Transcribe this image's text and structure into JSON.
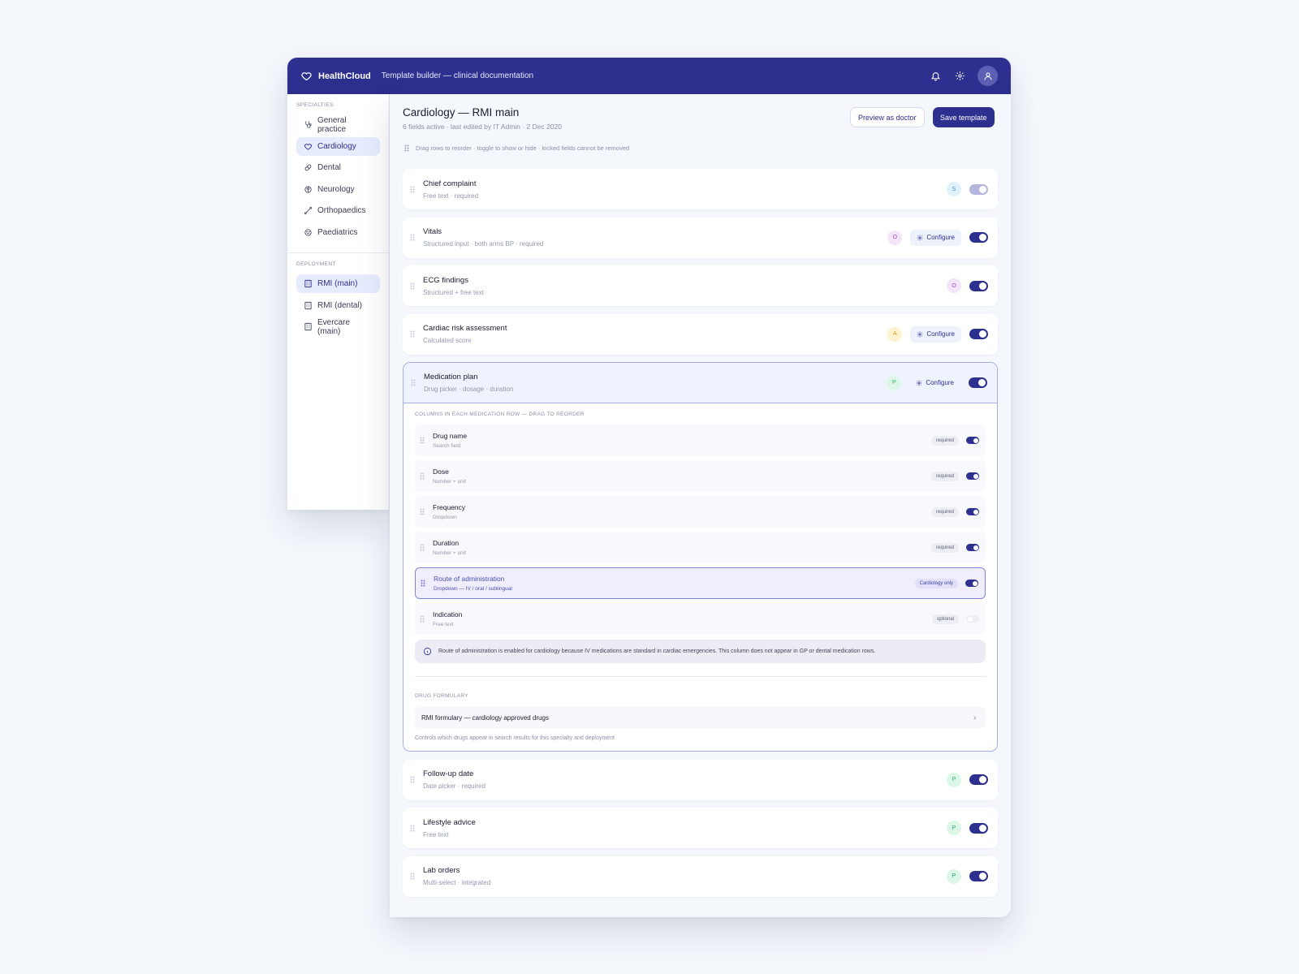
{
  "app": {
    "brand": "HealthCloud",
    "title": "Template builder — clinical documentation"
  },
  "sidebar": {
    "specialties_heading": "SPECIALTIES",
    "specialties": [
      {
        "label": "General practice",
        "icon": "stethoscope-icon",
        "active": false
      },
      {
        "label": "Cardiology",
        "icon": "heart-icon",
        "active": true
      },
      {
        "label": "Dental",
        "icon": "pill-icon",
        "active": false
      },
      {
        "label": "Neurology",
        "icon": "brain-icon",
        "active": false
      },
      {
        "label": "Orthopaedics",
        "icon": "bone-icon",
        "active": false
      },
      {
        "label": "Paediatrics",
        "icon": "baby-icon",
        "active": false
      }
    ],
    "deployment_heading": "DEPLOYMENT",
    "deployments": [
      {
        "label": "RMI (main)",
        "icon": "building-icon",
        "active": true
      },
      {
        "label": "RMI (dental)",
        "icon": "building-icon",
        "active": false
      },
      {
        "label": "Evercare (main)",
        "icon": "building-icon",
        "active": false
      }
    ]
  },
  "page": {
    "title": "Cardiology — RMI main",
    "subtitle": "6 fields active · last edited by IT Admin · 2 Dec 2020",
    "preview_button": "Preview as doctor",
    "save_button": "Save template",
    "hint": "Drag rows to reorder · toggle to show or hide · locked fields cannot be removed"
  },
  "fields_before": [
    {
      "name": "Chief complaint",
      "desc": "Free text · required",
      "badge": "S",
      "configure": false,
      "toggle": "locked"
    },
    {
      "name": "Vitals",
      "desc": "Structured input · both arms BP · required",
      "badge": "O",
      "configure": true,
      "toggle": "on"
    },
    {
      "name": "ECG findings",
      "desc": "Structured + free text",
      "badge": "O",
      "configure": false,
      "toggle": "on"
    },
    {
      "name": "Cardiac risk assessment",
      "desc": "Calculated score",
      "badge": "A",
      "configure": true,
      "toggle": "on"
    }
  ],
  "configure_label": "Configure",
  "medication": {
    "name": "Medication plan",
    "desc": "Drug picker · dosage · duration",
    "badge": "P",
    "columns_heading": "COLUMNS IN EACH MEDICATION ROW — DRAG TO REORDER",
    "columns": [
      {
        "name": "Drug name",
        "desc": "Search field",
        "tag": "required",
        "toggle": "on",
        "highlight": false
      },
      {
        "name": "Dose",
        "desc": "Number + unit",
        "tag": "required",
        "toggle": "on",
        "highlight": false
      },
      {
        "name": "Frequency",
        "desc": "Dropdown",
        "tag": "required",
        "toggle": "on",
        "highlight": false
      },
      {
        "name": "Duration",
        "desc": "Number + unit",
        "tag": "required",
        "toggle": "on",
        "highlight": false
      },
      {
        "name": "Route of administration",
        "desc": "Dropdown — IV / oral / sublingual",
        "tag": "Cardiology only",
        "toggle": "on",
        "highlight": true
      },
      {
        "name": "Indication",
        "desc": "Free text",
        "tag": "optional",
        "toggle": "off",
        "highlight": false
      }
    ],
    "info": "Route of administration is enabled for cardiology because IV medications are standard in cardiac emergencies. This column does not appear in GP or dental medication rows.",
    "formulary_heading": "DRUG FORMULARY",
    "formulary_value": "RMI formulary — cardiology approved drugs",
    "formulary_note": "Controls which drugs appear in search results for this specialty and deployment"
  },
  "fields_after": [
    {
      "name": "Follow-up date",
      "desc": "Date picker · required",
      "badge": "P",
      "configure": false,
      "toggle": "on"
    },
    {
      "name": "Lifestyle advice",
      "desc": "Free text",
      "badge": "P",
      "configure": false,
      "toggle": "on"
    },
    {
      "name": "Lab orders",
      "desc": "Multi-select · integrated",
      "badge": "P",
      "configure": false,
      "toggle": "on"
    }
  ],
  "colors": {
    "brand": "#2e3090",
    "accent_bg": "#e6ecfd",
    "highlight_border": "#7f84d6"
  }
}
